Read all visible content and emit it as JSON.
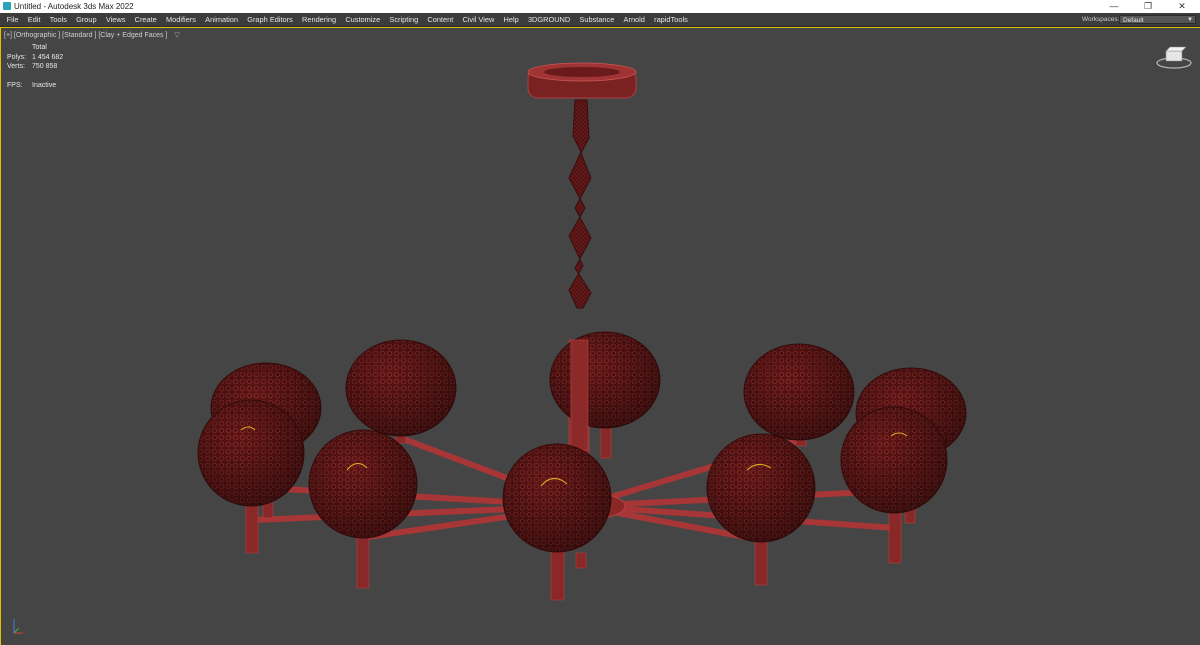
{
  "window": {
    "title": "Untitled - Autodesk 3ds Max 2022",
    "controls": [
      "—",
      "❐",
      "✕"
    ]
  },
  "menu": {
    "items": [
      "File",
      "Edit",
      "Tools",
      "Group",
      "Views",
      "Create",
      "Modifiers",
      "Animation",
      "Graph Editors",
      "Rendering",
      "Customize",
      "Scripting",
      "Content",
      "Civil View",
      "Help",
      "3DGROUND",
      "Substance",
      "Arnold",
      "rapidTools"
    ]
  },
  "workspaces": {
    "label": "Workspaces:",
    "value": "Default"
  },
  "viewport": {
    "label": "[+] [Orthographic ] [Standard ] [Clay + Edged Faces ]",
    "filter_icon": "funnel-icon",
    "stats": {
      "header": "Total",
      "polys_label": "Polys:",
      "polys": "1 454 682",
      "verts_label": "Verts:",
      "verts": "750 858",
      "fps_label": "FPS:",
      "fps": "Inactive"
    }
  },
  "colors": {
    "viewport_bg": "#454545",
    "model_wire": "#7a1e1e",
    "model_fill": "#5e1515",
    "selection": "#e0c000"
  }
}
